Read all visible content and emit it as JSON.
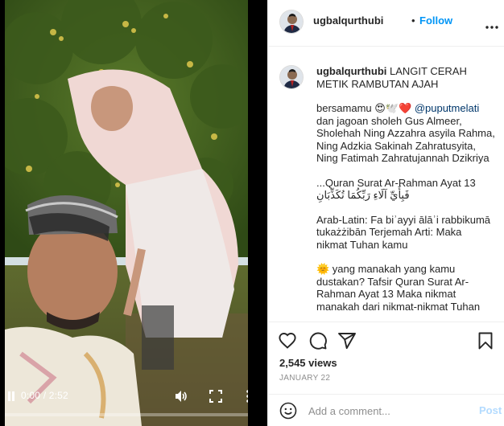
{
  "video": {
    "time_display": "0:00 / 2:52",
    "progress_fraction": 0.0
  },
  "header": {
    "username": "ugbalqurthubi",
    "separator": "•",
    "follow_label": "Follow"
  },
  "caption": {
    "username": "ugbalqurthubi",
    "title": "LANGIT CERAH METIK RAMBUTAN AJAH",
    "with_label": "bersamamu 😍🕊️❤️",
    "mention": "@puputmelati",
    "line_family": "dan jagoan sholeh Gus Almeer, Sholehah Ning Azzahra asyila Rahma, Ning Adzkia Sakinah Zahratusyita, Ning Fatimah Zahratujannah Dzikriya",
    "line_quran": "...Quran Surat Ar-Rahman Ayat 13\nفَبِأَيِّ آلَاءِ رَبِّكُمَا تُكَذِّبَانِ",
    "line_latin": "Arab-Latin: Fa biʾayyi ālāʾi rabbikumā tukażżibān Terjemah Arti: Maka nikmat Tuhan kamu",
    "line_tafsir": "🌞 yang manakah yang kamu dustakan? Tafsir Quran Surat Ar-Rahman Ayat 13 Maka nikmat manakah dari nikmat-nikmat Tuhan"
  },
  "stats": {
    "views": "2,545 views",
    "date": "JANUARY 22"
  },
  "comment": {
    "placeholder": "Add a comment...",
    "post_label": "Post"
  },
  "icons": {
    "heart": "heart-icon",
    "comment": "comment-icon",
    "share": "paper-plane-icon",
    "save": "bookmark-icon",
    "emoji": "smiley-icon",
    "more": "more-horizontal-icon"
  },
  "colors": {
    "accent": "#0095f6",
    "post_disabled": "#b3dbff",
    "mention": "#00376b",
    "muted": "#8e8e8e"
  }
}
